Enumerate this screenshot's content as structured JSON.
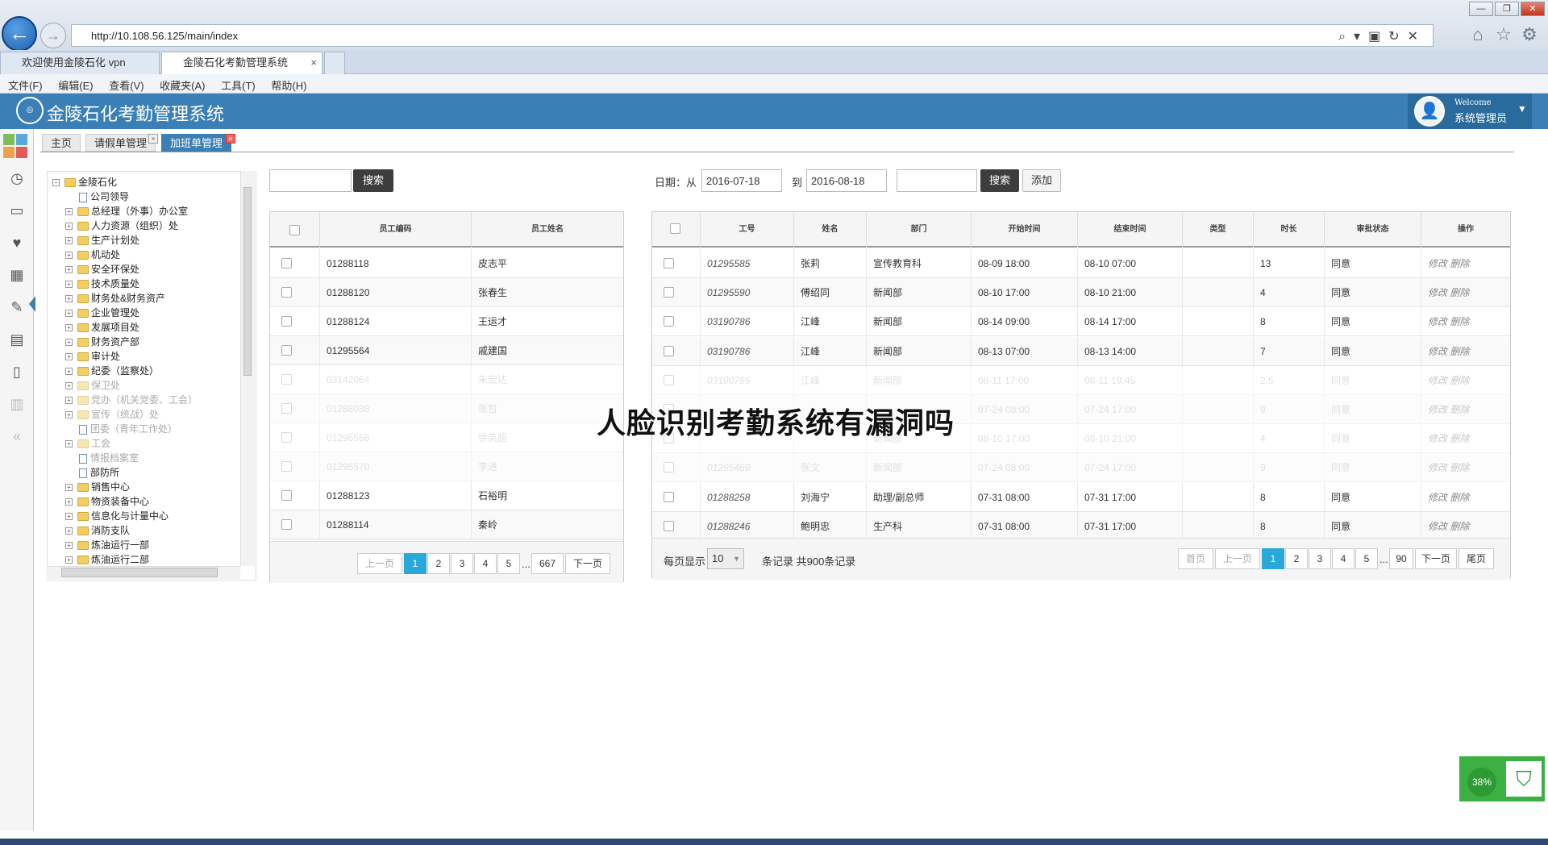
{
  "browser": {
    "url": "http://10.108.56.125/main/index",
    "tabs": [
      {
        "label": "欢迎使用金陵石化 vpn"
      },
      {
        "label": "金陵石化考勤管理系统"
      }
    ],
    "menu": [
      "文件(F)",
      "编辑(E)",
      "查看(V)",
      "收藏夹(A)",
      "工具(T)",
      "帮助(H)"
    ]
  },
  "app": {
    "title": "金陵石化考勤管理系统",
    "user": {
      "welcome": "Welcome",
      "name": "系统管理员"
    },
    "tabs": [
      "主页",
      "请假单管理",
      "加班单管理"
    ],
    "active_tab": "加班单管理"
  },
  "tree": {
    "items": [
      {
        "label": "金陵石化",
        "type": "folder",
        "level": 0,
        "toggle": "−"
      },
      {
        "label": "公司领导",
        "type": "file",
        "level": 1
      },
      {
        "label": "总经理（外事）办公室",
        "type": "folder",
        "level": 1,
        "toggle": "+"
      },
      {
        "label": "人力资源（组织）处",
        "type": "folder",
        "level": 1,
        "toggle": "+"
      },
      {
        "label": "生产计划处",
        "type": "folder",
        "level": 1,
        "toggle": "+"
      },
      {
        "label": "机动处",
        "type": "folder",
        "level": 1,
        "toggle": "+"
      },
      {
        "label": "安全环保处",
        "type": "folder",
        "level": 1,
        "toggle": "+"
      },
      {
        "label": "技术质量处",
        "type": "folder",
        "level": 1,
        "toggle": "+"
      },
      {
        "label": "财务处&财务资产",
        "type": "folder",
        "level": 1,
        "toggle": "+"
      },
      {
        "label": "企业管理处",
        "type": "folder",
        "level": 1,
        "toggle": "+"
      },
      {
        "label": "发展项目处",
        "type": "folder",
        "level": 1,
        "toggle": "+"
      },
      {
        "label": "财务资产部",
        "type": "folder",
        "level": 1,
        "toggle": "+"
      },
      {
        "label": "审计处",
        "type": "folder",
        "level": 1,
        "toggle": "+"
      },
      {
        "label": "纪委（监察处）",
        "type": "folder",
        "level": 1,
        "toggle": "+"
      },
      {
        "label": "保卫处",
        "type": "folder",
        "level": 1,
        "toggle": "+",
        "faded": true
      },
      {
        "label": "党办（机关党委、工会）",
        "type": "folder",
        "level": 1,
        "toggle": "+",
        "faded": true
      },
      {
        "label": "宣传（统战）处",
        "type": "folder",
        "level": 1,
        "toggle": "+",
        "faded": true
      },
      {
        "label": "团委（青年工作处）",
        "type": "file",
        "level": 1,
        "faded": true
      },
      {
        "label": "工会",
        "type": "folder",
        "level": 1,
        "toggle": "+",
        "faded": true
      },
      {
        "label": "情报档案室",
        "type": "file",
        "level": 1,
        "faded": true
      },
      {
        "label": "部防所",
        "type": "file",
        "level": 1
      },
      {
        "label": "销售中心",
        "type": "folder",
        "level": 1,
        "toggle": "+"
      },
      {
        "label": "物资装备中心",
        "type": "folder",
        "level": 1,
        "toggle": "+"
      },
      {
        "label": "信息化与计量中心",
        "type": "folder",
        "level": 1,
        "toggle": "+"
      },
      {
        "label": "消防支队",
        "type": "folder",
        "level": 1,
        "toggle": "+"
      },
      {
        "label": "炼油运行一部",
        "type": "folder",
        "level": 1,
        "toggle": "+"
      },
      {
        "label": "炼油运行二部",
        "type": "folder",
        "level": 1,
        "toggle": "+"
      }
    ]
  },
  "left_panel": {
    "search_button": "搜索",
    "search_value": "",
    "columns": [
      "员工编码",
      "员工姓名"
    ],
    "rows": [
      {
        "code": "01288118",
        "name": "皮志平"
      },
      {
        "code": "01288120",
        "name": "张春生"
      },
      {
        "code": "01288124",
        "name": "王运才"
      },
      {
        "code": "01295564",
        "name": "戚建国"
      },
      {
        "code": "03142064",
        "name": "朱宏达",
        "faded": true
      },
      {
        "code": "01288038",
        "name": "张哲",
        "faded": true
      },
      {
        "code": "01295568",
        "name": "徐英超",
        "faded": true
      },
      {
        "code": "01295570",
        "name": "李进",
        "faded": true
      },
      {
        "code": "01288123",
        "name": "石裕明"
      },
      {
        "code": "01288114",
        "name": "秦岭"
      }
    ],
    "pager": {
      "prev": "上一页",
      "pages": [
        "1",
        "2",
        "3",
        "4",
        "5"
      ],
      "ellipsis": "...",
      "last": "667",
      "next": "下一页",
      "current": "1"
    }
  },
  "right_panel": {
    "date_label": "日期：从",
    "date_from": "2016-07-18",
    "to_label": "到",
    "date_to": "2016-08-18",
    "search_value": "",
    "search_button": "搜索",
    "add_button": "添加",
    "columns": [
      "工号",
      "姓名",
      "部门",
      "开始时间",
      "结束时间",
      "类型",
      "时长",
      "审批状态",
      "操作"
    ],
    "rows": [
      {
        "id": "01295585",
        "name": "张莉",
        "dept": "宣传教育科",
        "start": "08-09 18:00",
        "end": "08-10 07:00",
        "type": "",
        "hours": "13",
        "status": "同意",
        "ops": "修改 删除"
      },
      {
        "id": "01295590",
        "name": "傅绍同",
        "dept": "新闻部",
        "start": "08-10 17:00",
        "end": "08-10 21:00",
        "type": "",
        "hours": "4",
        "status": "同意",
        "ops": "修改 删除"
      },
      {
        "id": "03190786",
        "name": "江峰",
        "dept": "新闻部",
        "start": "08-14 09:00",
        "end": "08-14 17:00",
        "type": "",
        "hours": "8",
        "status": "同意",
        "ops": "修改 删除"
      },
      {
        "id": "03190786",
        "name": "江峰",
        "dept": "新闻部",
        "start": "08-13 07:00",
        "end": "08-13 14:00",
        "type": "",
        "hours": "7",
        "status": "同意",
        "ops": "修改 删除"
      },
      {
        "id": "03190786",
        "name": "江峰",
        "dept": "新闻部",
        "start": "08-11 17:00",
        "end": "08-11 19:45",
        "type": "",
        "hours": "2.5",
        "status": "同意",
        "ops": "修改 删除",
        "faded": true
      },
      {
        "id": "",
        "name": "",
        "dept": "",
        "start": "07-24 08:00",
        "end": "07-24 17:00",
        "type": "",
        "hours": "9",
        "status": "同意",
        "ops": "修改 删除",
        "faded": true
      },
      {
        "id": "",
        "name": "",
        "dept": "新闻部",
        "start": "08-10 17:00",
        "end": "08-10 21:00",
        "type": "",
        "hours": "4",
        "status": "同意",
        "ops": "修改 删除",
        "faded": true
      },
      {
        "id": "01295469",
        "name": "张文",
        "dept": "新闻部",
        "start": "07-24 08:00",
        "end": "07-24 17:00",
        "type": "",
        "hours": "9",
        "status": "同意",
        "ops": "修改 删除",
        "faded": true
      },
      {
        "id": "01288258",
        "name": "刘海宁",
        "dept": "助理/副总师",
        "start": "07-31 08:00",
        "end": "07-31 17:00",
        "type": "",
        "hours": "8",
        "status": "同意",
        "ops": "修改 删除"
      },
      {
        "id": "01288246",
        "name": "鲍明忠",
        "dept": "生产科",
        "start": "07-31 08:00",
        "end": "07-31 17:00",
        "type": "",
        "hours": "8",
        "status": "同意",
        "ops": "修改 删除"
      }
    ],
    "page_size_label": "每页显示",
    "page_size": "10",
    "records_label": "条记录 共900条记录",
    "pager": {
      "first": "首页",
      "prev": "上一页",
      "pages": [
        "1",
        "2",
        "3",
        "4",
        "5"
      ],
      "ellipsis": "...",
      "last": "90",
      "next": "下一页",
      "end": "尾页",
      "current": "1"
    }
  },
  "overlay_title": "人脸识别考勤系统有漏洞吗",
  "progress_widget": {
    "percent": "38%"
  },
  "colors": {
    "header": "#3a80b6",
    "accent": "#29a8d9",
    "dark_button": "#3d3d3d"
  }
}
